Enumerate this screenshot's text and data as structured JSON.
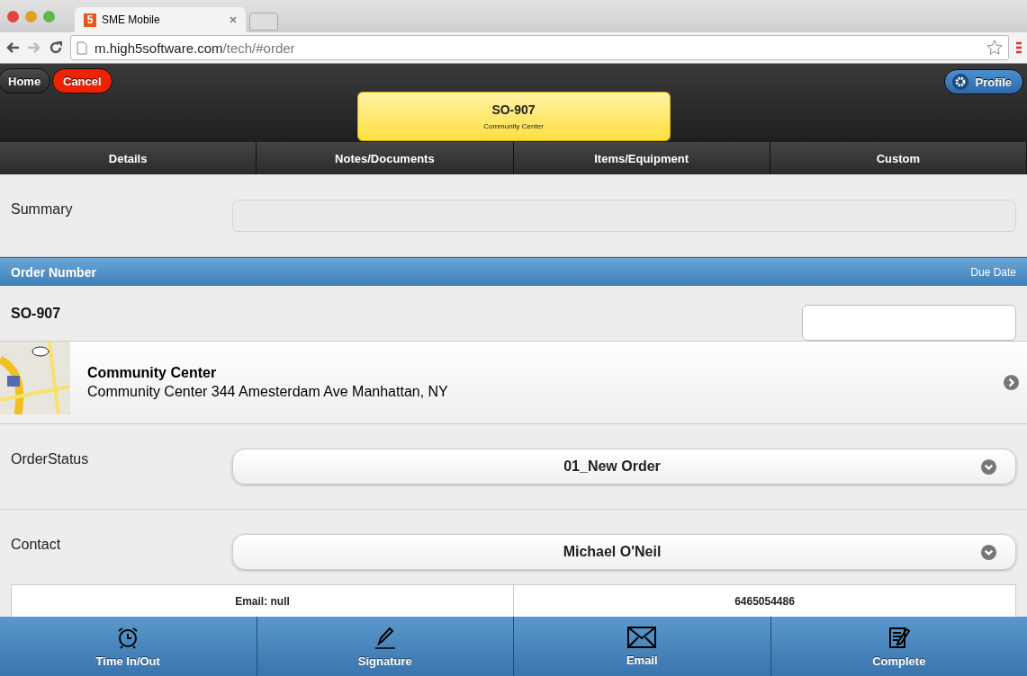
{
  "browser": {
    "tab_title": "SME Mobile",
    "favicon": "5",
    "url_host": "m.high5software.com",
    "url_path": "/tech/#order"
  },
  "header": {
    "home": "Home",
    "cancel": "Cancel",
    "profile": "Profile",
    "order_title": "SO-907",
    "order_subtitle": "Community Center"
  },
  "tabs": [
    {
      "label": "Details"
    },
    {
      "label": "Notes/Documents"
    },
    {
      "label": "Items/Equipment"
    },
    {
      "label": "Custom"
    }
  ],
  "summary": {
    "label": "Summary"
  },
  "order_bar": {
    "left": "Order Number",
    "right": "Due Date"
  },
  "order_number": "SO-907",
  "location": {
    "name": "Community Center",
    "address": "Community Center 344 Amesterdam Ave Manhattan, NY"
  },
  "order_status": {
    "label": "OrderStatus",
    "value": "01_New Order"
  },
  "contact": {
    "label": "Contact",
    "value": "Michael O'Neil",
    "email": "Email: null",
    "phone": "6465054486"
  },
  "footer": [
    {
      "kind": "alarm",
      "label": "Time In/Out"
    },
    {
      "kind": "pen",
      "label": "Signature"
    },
    {
      "kind": "mail",
      "label": "Email"
    },
    {
      "kind": "notepad",
      "label": "Complete"
    }
  ]
}
